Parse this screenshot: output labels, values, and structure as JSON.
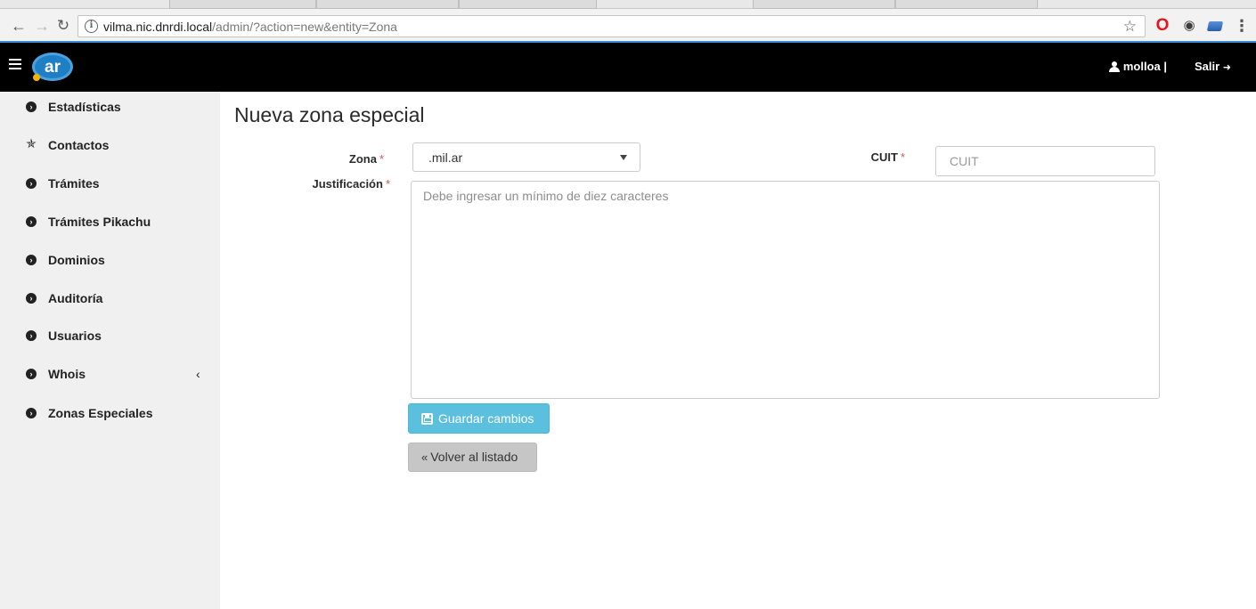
{
  "browser": {
    "url_host": "vilma.nic.dnrdi.local",
    "url_path": "/admin/?action=new&entity=Zona",
    "icons": [
      "back-arrow-icon",
      "forward-arrow-icon",
      "reload-icon",
      "info-icon",
      "bookmark-star-icon",
      "opera-icon",
      "eye-icon",
      "extension-icon",
      "menu-dots-icon"
    ]
  },
  "navbar": {
    "logo_text": "ar",
    "username": "molloa |",
    "logout_label": "Salir"
  },
  "sidebar": {
    "items": [
      {
        "label": "Estadísticas",
        "icon": "chevron-circle-icon"
      },
      {
        "label": "Contactos",
        "icon": "person-icon"
      },
      {
        "label": "Trámites",
        "icon": "chevron-circle-icon"
      },
      {
        "label": "Trámites Pikachu",
        "icon": "chevron-circle-icon"
      },
      {
        "label": "Dominios",
        "icon": "chevron-circle-icon"
      },
      {
        "label": "Auditoría",
        "icon": "chevron-circle-icon"
      },
      {
        "label": "Usuarios",
        "icon": "chevron-circle-icon"
      },
      {
        "label": "Whois",
        "icon": "chevron-circle-icon",
        "has_submenu": true
      },
      {
        "label": "Zonas Especiales",
        "icon": "chevron-circle-icon"
      }
    ]
  },
  "form": {
    "title": "Nueva zona especial",
    "zona_label": "Zona",
    "zona_value": ".mil.ar",
    "cuit_label": "CUIT",
    "cuit_placeholder": "CUIT",
    "justificacion_label": "Justificación",
    "justificacion_placeholder": "Debe ingresar un mínimo de diez caracteres",
    "required_mark": "*",
    "save_label": "Guardar cambios",
    "back_label": "Volver al listado"
  },
  "colors": {
    "navbar_bg": "#000000",
    "sidebar_bg": "#f0f0f0",
    "save_button": "#5bc0de",
    "back_button": "#c6c6c6",
    "required": "#d9534f",
    "logo_blue": "#4aa3df"
  }
}
